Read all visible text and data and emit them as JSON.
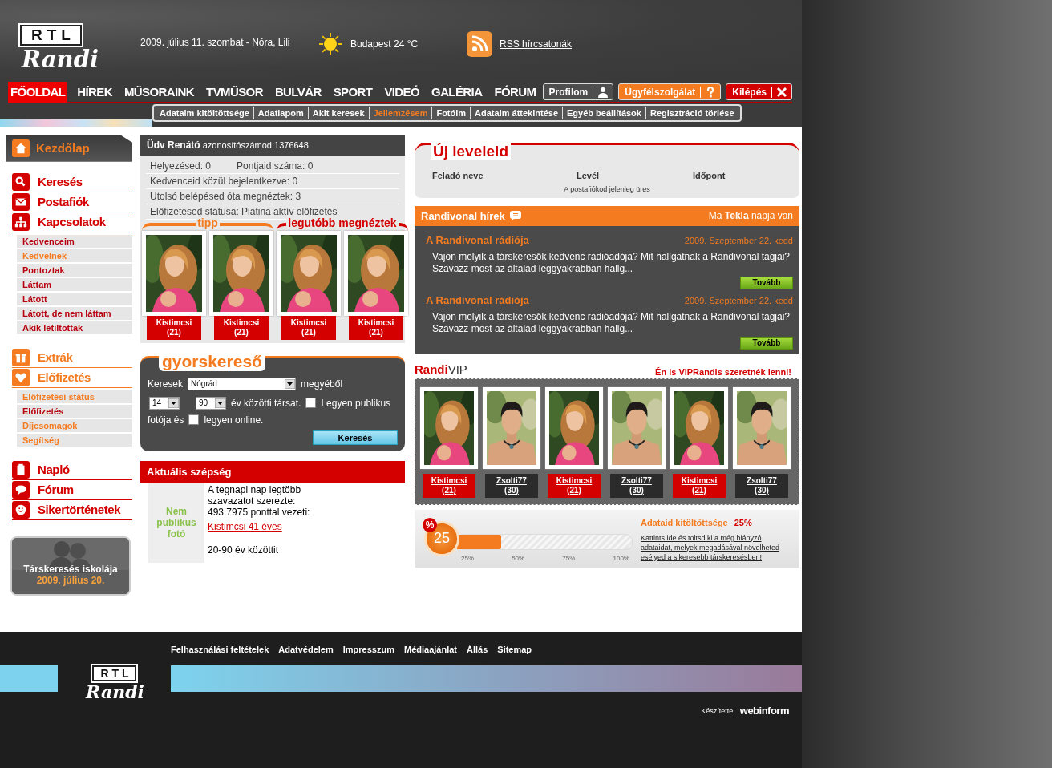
{
  "header": {
    "logo_top": "RTL",
    "logo_bottom": "Randi",
    "date": "2009. július 11. szombat - Nóra, Lili",
    "weather": "Budapest 24 °C",
    "rss": "RSS hírcsatonák"
  },
  "main_nav": [
    {
      "label": "FŐOLDAL",
      "selected": true
    },
    {
      "label": "HÍREK",
      "selected": false
    },
    {
      "label": "MŰSORAINK",
      "selected": false
    },
    {
      "label": "TVMŰSOR",
      "selected": false
    },
    {
      "label": "BULVÁR",
      "selected": false
    },
    {
      "label": "SPORT",
      "selected": false
    },
    {
      "label": "VIDEÓ",
      "selected": false
    },
    {
      "label": "GALÉRIA",
      "selected": false
    },
    {
      "label": "FÓRUM",
      "selected": false
    }
  ],
  "account_buttons": [
    {
      "label": "Profilom",
      "kind": "profile"
    },
    {
      "label": "Ügyfélszolgálat",
      "kind": "help"
    },
    {
      "label": "Kilépés",
      "kind": "logout"
    }
  ],
  "sub_nav": [
    {
      "label": "Adataim kitöltöttsége",
      "selected": false
    },
    {
      "label": "Adatlapom",
      "selected": false
    },
    {
      "label": "Akit keresek",
      "selected": false
    },
    {
      "label": "Jellemzésem",
      "selected": true
    },
    {
      "label": "Fotóim",
      "selected": false
    },
    {
      "label": "Adataim áttekintése",
      "selected": false
    },
    {
      "label": "Egyéb beállítások",
      "selected": false
    },
    {
      "label": "Regisztráció törlése",
      "selected": false
    }
  ],
  "sidebar": {
    "home": "Kezdőlap",
    "sections": [
      {
        "items": [
          {
            "label": "Keresés",
            "kind": "search",
            "color": "#d40000"
          },
          {
            "label": "Postafiók",
            "kind": "mail",
            "color": "#d40000"
          },
          {
            "label": "Kapcsolatok",
            "kind": "network",
            "color": "#d40000",
            "children": [
              {
                "label": "Kedvenceim",
                "visited": false
              },
              {
                "label": "Kedvelnek",
                "visited": true
              },
              {
                "label": "Pontoztak",
                "visited": false
              },
              {
                "label": "Láttam",
                "visited": false
              },
              {
                "label": "Látott",
                "visited": false
              },
              {
                "label": "Látott, de nem láttam",
                "visited": false
              },
              {
                "label": "Akik letiltottak",
                "visited": false
              }
            ]
          }
        ]
      },
      {
        "items": [
          {
            "label": "Extrák",
            "kind": "gift",
            "color": "#f47b20"
          },
          {
            "label": "Előfizetés",
            "kind": "heart",
            "color": "#f47b20",
            "children": [
              {
                "label": "Előfizetési státus",
                "visited": true
              },
              {
                "label": "Előfizetés",
                "visited": false
              },
              {
                "label": "Díjcsomagok",
                "visited": true
              },
              {
                "label": "Segítség",
                "visited": true
              }
            ]
          }
        ]
      },
      {
        "items": [
          {
            "label": "Napló",
            "kind": "notepad",
            "color": "#d40000"
          },
          {
            "label": "Fórum",
            "kind": "chat",
            "color": "#d40000"
          },
          {
            "label": "Sikertörténetek",
            "kind": "smiley",
            "color": "#d40000"
          }
        ]
      }
    ],
    "promo": {
      "title": "Társkeresés iskolája",
      "date": "2009. július 20."
    }
  },
  "welcome": {
    "greeting": "Üdv Renátó",
    "id_text": "azonosítószámod:1376648",
    "rows": [
      {
        "cells": [
          "Helyezésed: 0",
          "Pontjaid száma: 0"
        ]
      },
      {
        "cells": [
          "Kedvenceid közül bejelentkezve: 0"
        ]
      },
      {
        "cells": [
          "Utolsó belépésed óta megnéztek: 3"
        ]
      },
      {
        "cells": [
          "Előfizetésed státusa: Platina aktív előfizetés"
        ]
      }
    ]
  },
  "photo_groups": [
    {
      "title": "tipp",
      "kind": "tip",
      "profiles": [
        {
          "name": "Kistimcsi",
          "age": "(21)",
          "kind": "female"
        },
        {
          "name": "Kistimcsi",
          "age": "(21)",
          "kind": "female"
        }
      ]
    },
    {
      "title": "legutóbb megnéztek",
      "kind": "recent",
      "profiles": [
        {
          "name": "Kistimcsi",
          "age": "(21)",
          "kind": "female"
        },
        {
          "name": "Kistimcsi",
          "age": "(21)",
          "kind": "female"
        }
      ]
    }
  ],
  "quick_search": {
    "title": "gyorskereső",
    "label": "Keresek",
    "county": "Nógrád",
    "county_suffix": "megyéből",
    "age_from": "14",
    "age_to": "90",
    "age_text": "év közötti társat.",
    "public_photo": {
      "label": "Legyen publikus",
      "checked": false
    },
    "photo_text": "fotója és",
    "online": {
      "label": "legyen online.",
      "checked": false
    },
    "button": "Keresés"
  },
  "beauty": {
    "title": "Aktuális szépség",
    "photo_placeholder": "Nem publikus fotó",
    "lines": [
      "A tegnapi nap legtöbb szavazatot szerezte:",
      "493.7975 ponttal vezeti:"
    ],
    "link": "Kistimcsi 41 éves",
    "range": "20-90 év közöttit"
  },
  "mail": {
    "title": "Új leveleid",
    "columns": [
      "Feladó neve",
      "Levél",
      "Időpont"
    ],
    "empty": "A postafiókod jelenleg üres"
  },
  "news": {
    "title": "Randivonal hírek",
    "nameday": "Ma **Tekla** napja van",
    "items": [
      {
        "title": "A Randivonal rádiója",
        "date": "2009. Szeptember 22. kedd",
        "text": "Vajon melyik a társkeresők kedvenc rádióadója? Mit hallgatnak a Randivonal tagjai? Szavazz most az általad leggyakrabban hallg...",
        "button": "Tovább"
      },
      {
        "title": "A Randivonal rádiója",
        "date": "2009. Szeptember 22. kedd",
        "text": "Vajon melyik a társkeresők kedvenc rádióadója? Mit hallgatnak a Randivonal tagjai? Szavazz most az általad leggyakrabban hallg...",
        "button": "Tovább"
      }
    ]
  },
  "vip": {
    "logo_a": "Randi",
    "logo_b": "VIP",
    "link": "Én is VIPRandis szeretnék lenni!",
    "profiles": [
      {
        "name": "Kistimcsi",
        "age": "(21)",
        "kind": "female"
      },
      {
        "name": "Zsolti77",
        "age": "(30)",
        "kind": "male"
      },
      {
        "name": "Kistimcsi",
        "age": "(21)",
        "kind": "female"
      },
      {
        "name": "Zsolti77",
        "age": "(30)",
        "kind": "male"
      },
      {
        "name": "Kistimcsi",
        "age": "(21)",
        "kind": "female"
      },
      {
        "name": "Zsolti77",
        "age": "(30)",
        "kind": "male"
      }
    ]
  },
  "completion": {
    "badge": "%",
    "number": "25",
    "level": 0.25,
    "ticks": [
      "25%",
      "50%",
      "75%",
      "100%"
    ],
    "title": "Adataid kitöltöttsége",
    "value": "25%",
    "link": "Kattints ide és töltsd ki a még hiányzó adataidat, melyek megadásával növelheted esélyed a sikeresebb társkeresésben!"
  },
  "footer": {
    "links": [
      "Felhasználási feltételek",
      "Adatvédelem",
      "Impresszum",
      "Médiaajánlat",
      "Állás",
      "Sitemap"
    ],
    "logo_top": "RTL",
    "logo_bottom": "Randi",
    "credit_label": "Készítette:",
    "credit": "webinform"
  }
}
